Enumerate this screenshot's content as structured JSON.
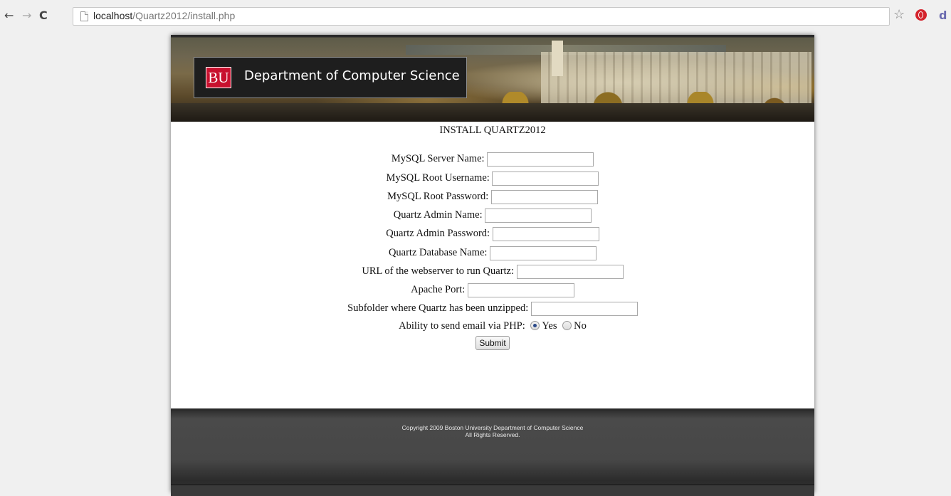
{
  "browser": {
    "url_host": "localhost",
    "url_path": "/Quartz2012/install.php",
    "back_icon": "arrow-left-icon",
    "forward_icon": "arrow-right-icon",
    "reload_icon": "reload-icon"
  },
  "header": {
    "logo_text": "BU",
    "department": "Department of Computer Science",
    "brand_color": "#c8102e"
  },
  "form": {
    "title": "INSTALL QUARTZ2012",
    "fields": [
      {
        "label": "MySQL Server Name:",
        "value": ""
      },
      {
        "label": "MySQL Root Username:",
        "value": ""
      },
      {
        "label": "MySQL Root Password:",
        "value": ""
      },
      {
        "label": "Quartz Admin Name:",
        "value": ""
      },
      {
        "label": "Quartz Admin Password:",
        "value": ""
      },
      {
        "label": "Quartz Database Name:",
        "value": ""
      },
      {
        "label": "URL of the webserver to run Quartz:",
        "value": ""
      },
      {
        "label": "Apache Port:",
        "value": ""
      },
      {
        "label": "Subfolder where Quartz has been unzipped:",
        "value": ""
      }
    ],
    "email": {
      "label": "Ability to send email via PHP:",
      "yes_label": "Yes",
      "no_label": "No",
      "selected": "Yes"
    },
    "submit_label": "Submit"
  },
  "footer": {
    "line1": "Copyright 2009 Boston University Department of Computer Science",
    "line2": "All Rights Reserved."
  }
}
